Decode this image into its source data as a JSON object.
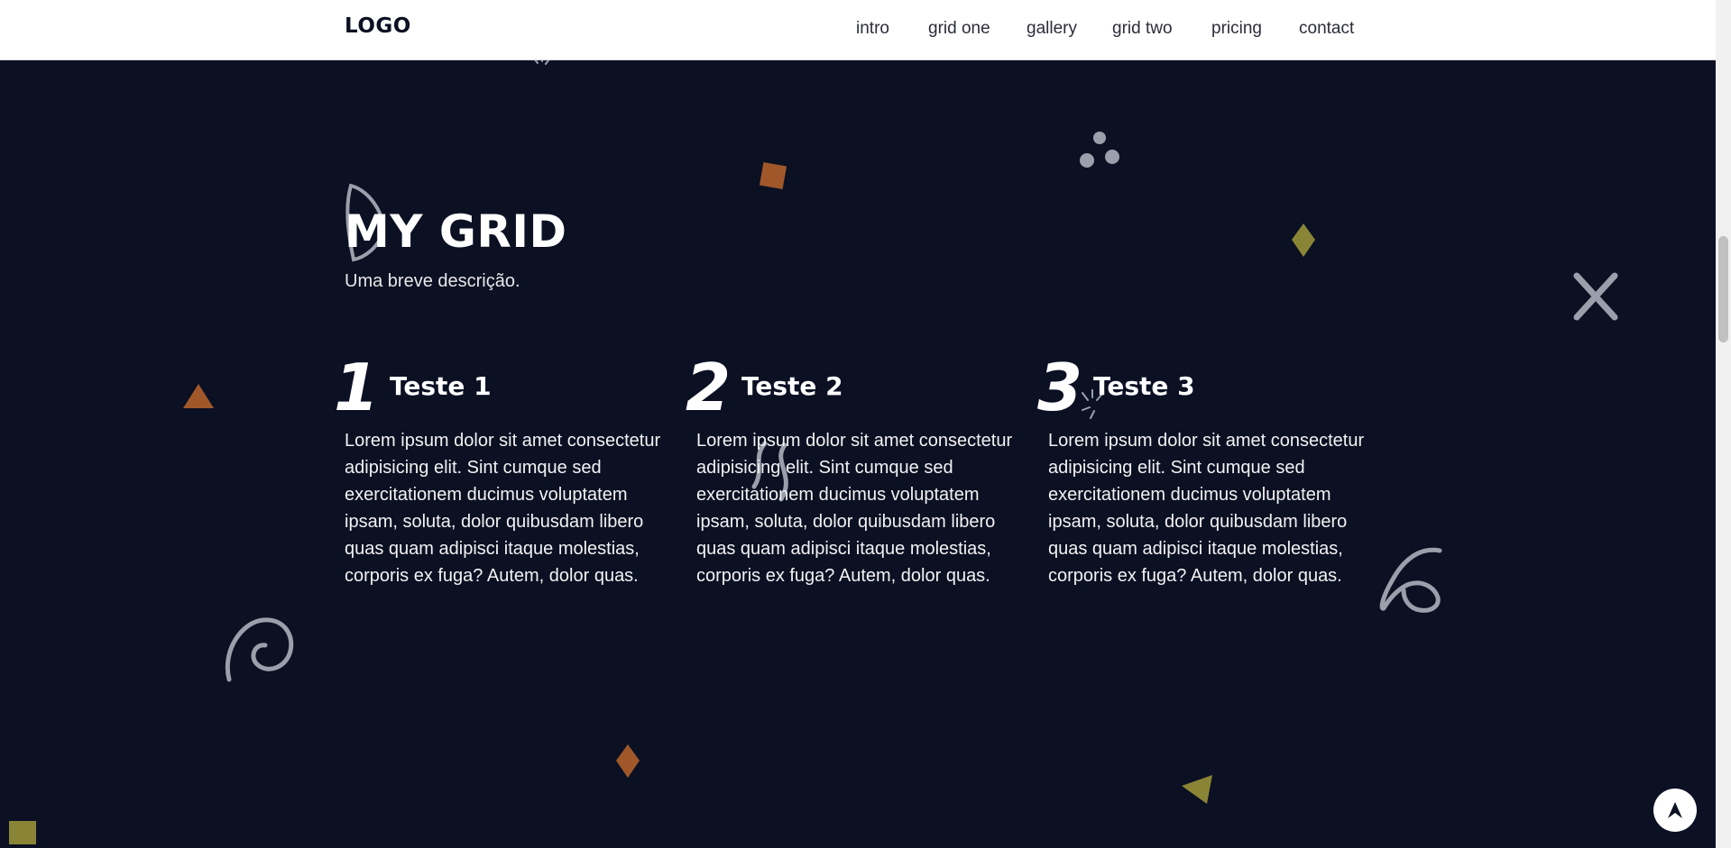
{
  "header": {
    "logo": "LOGO",
    "nav": [
      {
        "label": "intro"
      },
      {
        "label": "grid one"
      },
      {
        "label": "gallery"
      },
      {
        "label": "grid two"
      },
      {
        "label": "pricing"
      },
      {
        "label": "contact"
      }
    ]
  },
  "section": {
    "title": "MY GRID",
    "subtitle": "Uma breve descrição.",
    "items": [
      {
        "number": "1",
        "title": "Teste 1",
        "text": "Lorem ipsum dolor sit amet consectetur adipisicing elit. Sint cumque sed exercitationem ducimus voluptatem ipsam, soluta, dolor quibusdam libero quas quam adipisci itaque molestias, corporis ex fuga? Autem, dolor quas."
      },
      {
        "number": "2",
        "title": "Teste 2",
        "text": "Lorem ipsum dolor sit amet consectetur adipisicing elit. Sint cumque sed exercitationem ducimus voluptatem ipsam, soluta, dolor quibusdam libero quas quam adipisci itaque molestias, corporis ex fuga? Autem, dolor quas."
      },
      {
        "number": "3",
        "title": "Teste 3",
        "text": "Lorem ipsum dolor sit amet consectetur adipisicing elit. Sint cumque sed exercitationem ducimus voluptatem ipsam, soluta, dolor quibusdam libero quas quam adipisci itaque molestias, corporis ex fuga? Autem, dolor quas."
      }
    ]
  },
  "colors": {
    "background": "#0b1023",
    "header_bg": "#ffffff",
    "accent_orange": "#a0582a",
    "accent_olive": "#8a8436",
    "shape_gray": "#9aa0ab"
  },
  "icons": {
    "back_to_top": "arrow-up-icon"
  }
}
